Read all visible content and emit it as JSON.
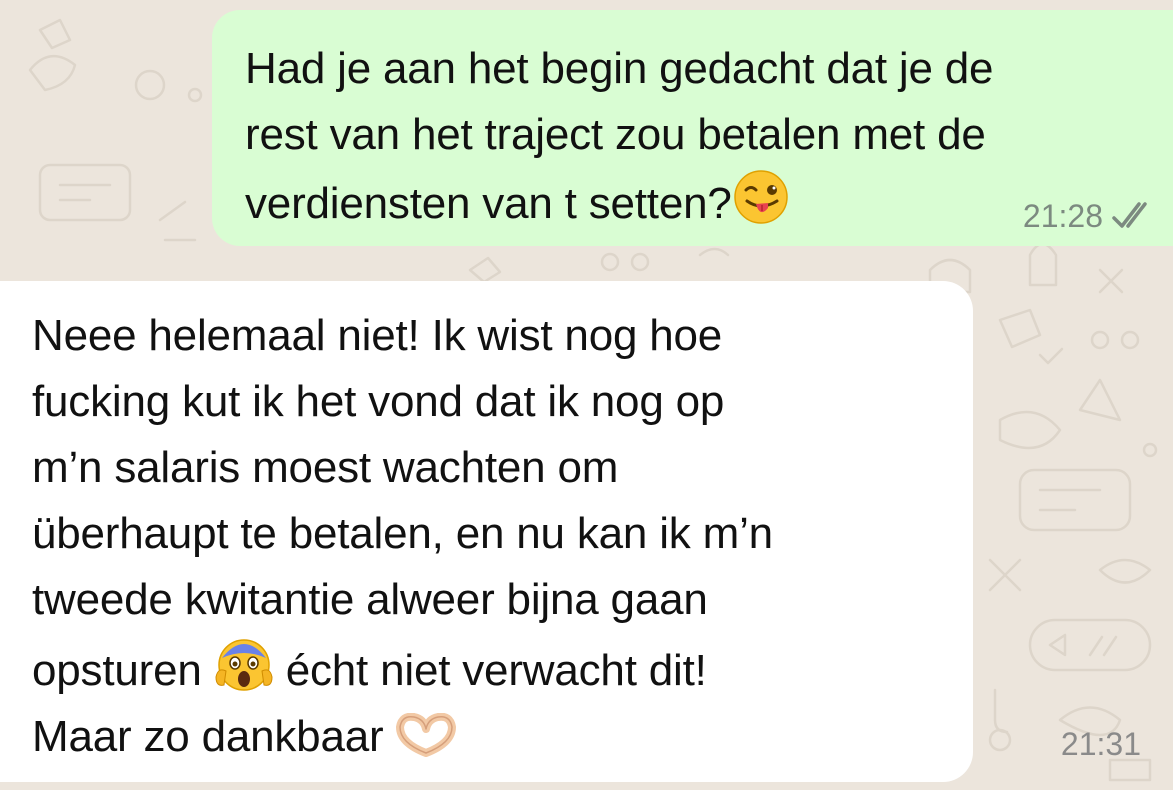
{
  "chat": {
    "messages": [
      {
        "direction": "outgoing",
        "lines": [
          "Had je aan het begin gedacht dat je de",
          "rest van het traject zou betalen met de",
          "verdiensten van t setten?"
        ],
        "emoji": "winking-tongue-face",
        "time": "21:28",
        "status": "read-double-check"
      },
      {
        "direction": "incoming",
        "lines": [
          "Neee helemaal niet! Ik wist nog hoe",
          "fucking kut ik het vond dat ik nog op",
          "m’n salaris moest wachten om",
          "überhaupt te betalen, en nu kan ik m’n",
          "tweede kwitantie alweer bijna gaan",
          "opsturen",
          "écht niet verwacht dit!",
          "Maar zo dankbaar"
        ],
        "emojis": [
          "screaming-face",
          "heart-hands"
        ],
        "time": "21:31"
      }
    ]
  },
  "colors": {
    "background": "#ece5dc",
    "outgoing_bubble": "#d9fdd3",
    "incoming_bubble": "#ffffff",
    "meta_text": "#7c8a80"
  }
}
